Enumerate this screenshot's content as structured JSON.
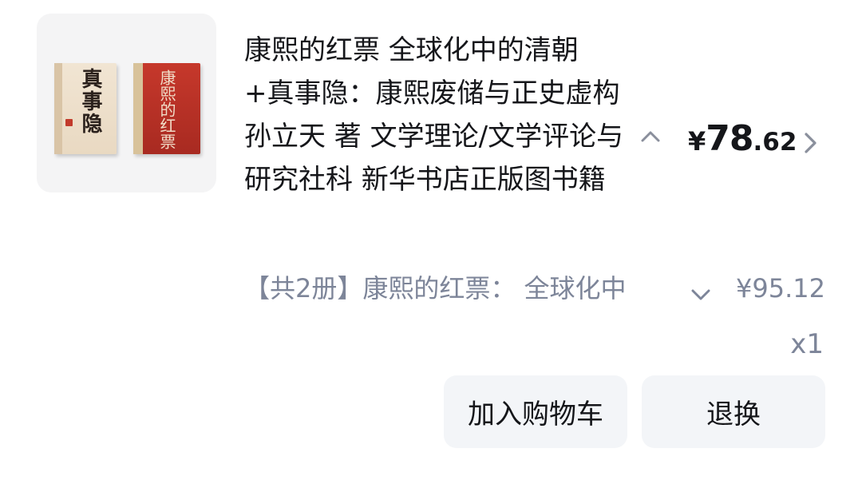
{
  "product": {
    "title": "康熙的红票 全球化中的清朝+真事隐：康熙废储与正史虚构 孙立天 著 文学理论/文学评论与研究社科 新华书店正版图书籍",
    "thumbnail": {
      "left_book_title": "真事隐",
      "right_book_title": "康熙的红票"
    },
    "price": {
      "currency": "¥",
      "integer": "78",
      "decimal": ".62"
    }
  },
  "variant": {
    "label": "【共2册】康熙的红票： 全球化中",
    "price": "¥95.12"
  },
  "quantity": "x1",
  "actions": {
    "add_to_cart": "加入购物车",
    "return_exchange": "退换"
  },
  "icons": {
    "collapse": "chevron-up-icon",
    "detail": "chevron-right-icon",
    "variant_select": "chevron-down-icon"
  },
  "colors": {
    "text_primary": "#15161a",
    "text_secondary": "#7d8599",
    "button_bg": "#f3f5f8",
    "thumb_bg": "#f4f4f5"
  }
}
